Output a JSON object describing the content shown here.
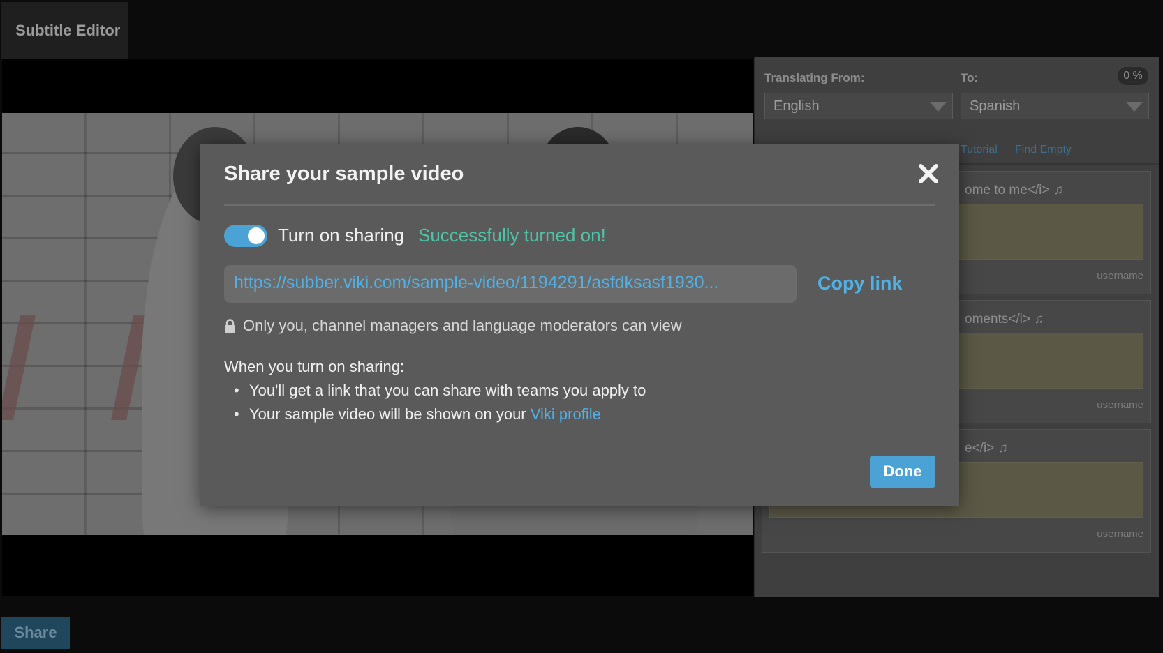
{
  "app": {
    "tab_title": "Subtitle Editor",
    "share_button_label": "Share"
  },
  "panel": {
    "from_label": "Translating From:",
    "to_label": "To:",
    "progress": "0 %",
    "from_language": "English",
    "to_language": "Spanish",
    "links": [
      "Tutorial",
      "Find Empty"
    ],
    "subtitles": [
      {
        "text": "ome to me</i> ♫",
        "user": "username"
      },
      {
        "text": "oments</i> ♫",
        "user": "username"
      },
      {
        "text": "e</i> ♫",
        "user": "username"
      }
    ]
  },
  "modal": {
    "title": "Share your sample video",
    "toggle_label": "Turn on sharing",
    "toggle_on": true,
    "status_text": "Successfully turned on!",
    "share_url": "https://subber.viki.com/sample-video/1194291/asfdksasf1930...",
    "copy_label": "Copy link",
    "privacy_note": "Only you, channel managers and language moderators can view",
    "info_heading": "When you turn on sharing:",
    "bullet_1": "You'll get a link that you can share with teams you apply to",
    "bullet_2_prefix": "Your sample video will be shown on your ",
    "bullet_2_link": "Viki profile",
    "done_label": "Done"
  },
  "colors": {
    "accent": "#4aa3d4",
    "link": "#4fb1e6",
    "success": "#4ec3a6",
    "modal_bg": "#5a5a5a"
  }
}
